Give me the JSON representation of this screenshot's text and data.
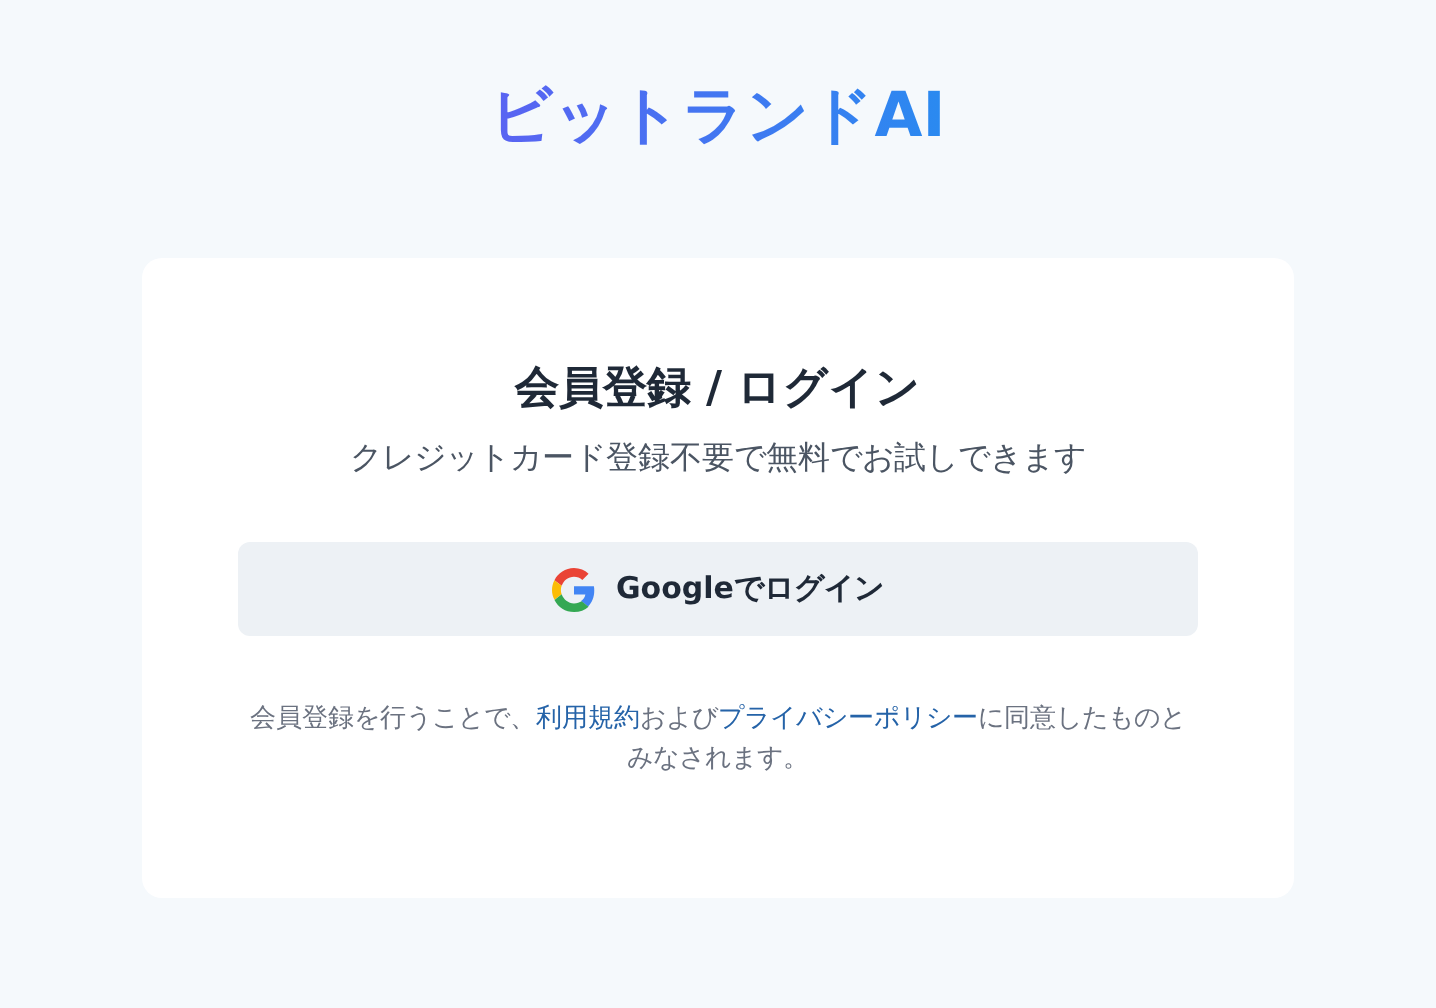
{
  "logo": "ビットランドAI",
  "card": {
    "title": "会員登録 / ログイン",
    "subtitle": "クレジットカード登録不要で無料でお試しできます",
    "button": "Googleでログイン",
    "notice": [
      {
        "kind": "text",
        "text": "会員登録を行うことで、"
      },
      {
        "kind": "link",
        "text": "利用規約"
      },
      {
        "kind": "text",
        "text": "および"
      },
      {
        "kind": "link",
        "text": "プライバシーポリシー"
      },
      {
        "kind": "text",
        "text": "に同意したものとみなされます。"
      }
    ]
  }
}
